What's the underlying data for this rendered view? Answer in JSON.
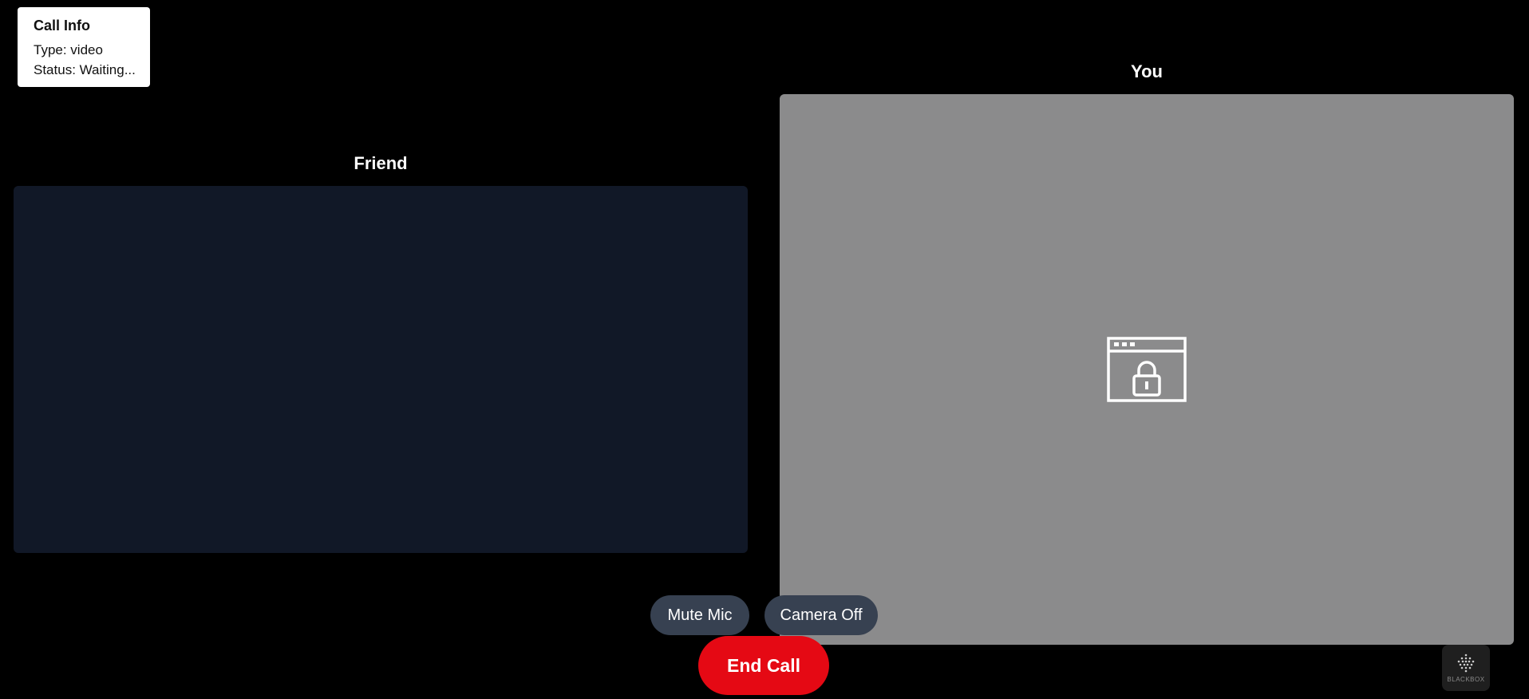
{
  "call_info": {
    "title": "Call Info",
    "type_line": "Type: video",
    "status_line": "Status: Waiting..."
  },
  "friend_panel": {
    "label": "Friend"
  },
  "you_panel": {
    "label": "You",
    "icon": "locked-window-icon"
  },
  "controls": {
    "mute_label": "Mute Mic",
    "camera_label": "Camera Off",
    "end_label": "End Call"
  },
  "badge": {
    "text": "BLACKBOX",
    "icon": "blackbox-logo-icon"
  },
  "colors": {
    "background": "#000000",
    "friend_video_bg": "#111827",
    "you_video_bg": "#8b8b8c",
    "control_bg": "#374151",
    "end_call": "#e50914"
  }
}
